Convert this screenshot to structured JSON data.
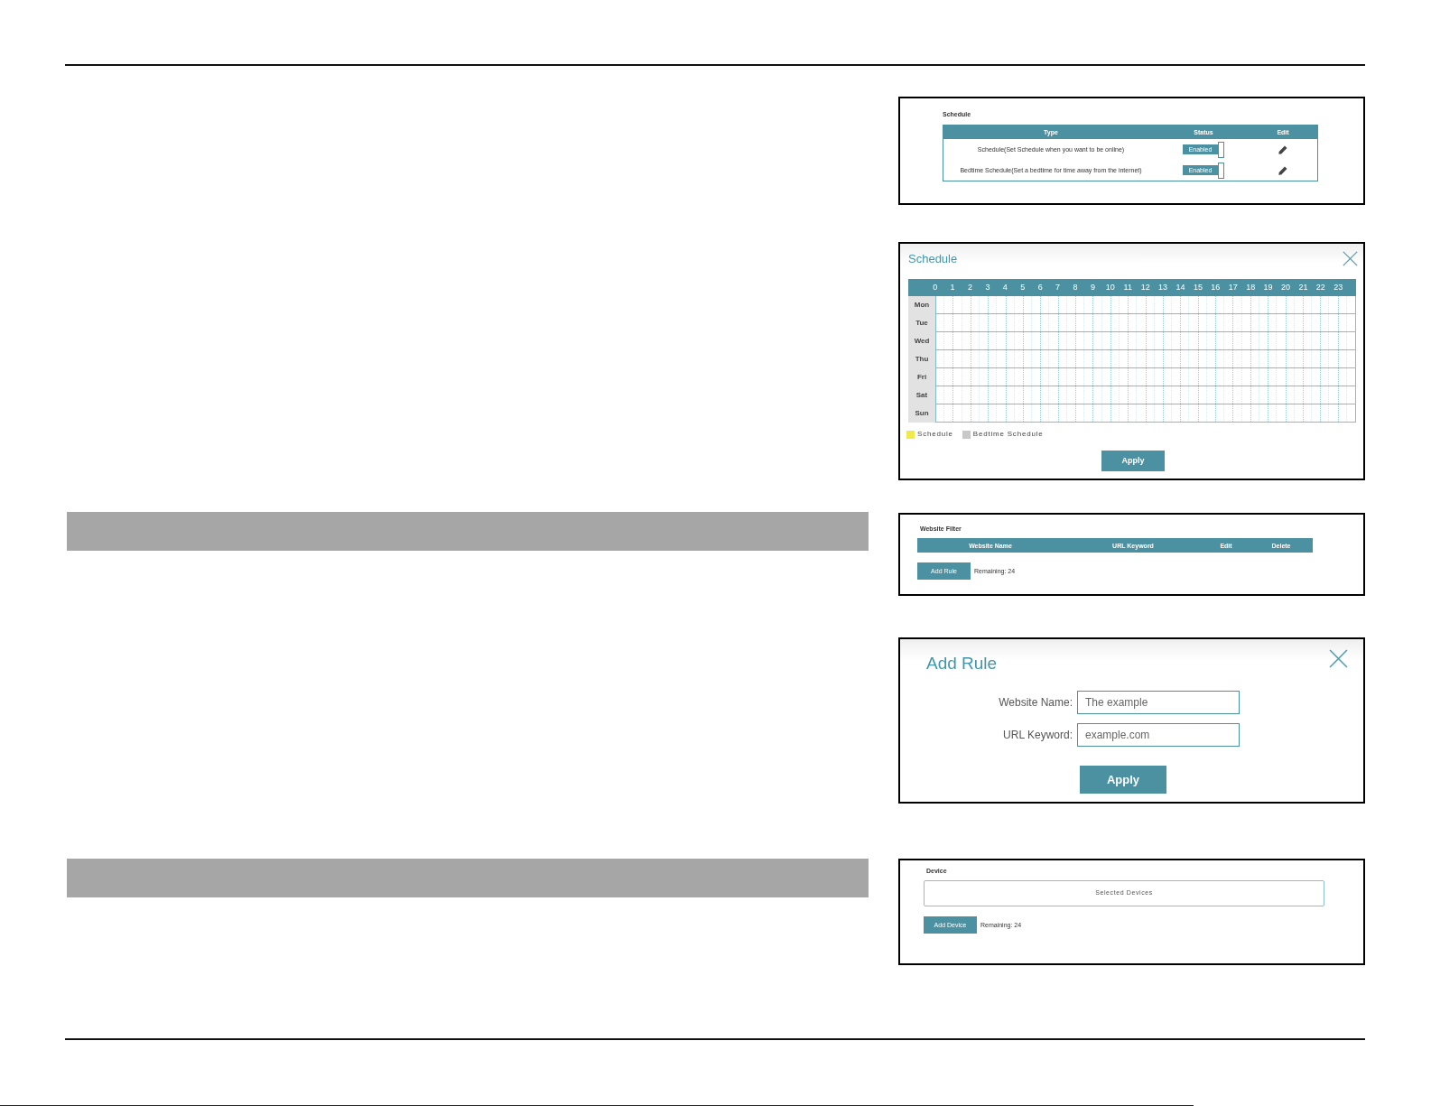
{
  "schedule_table_panel": {
    "title": "Schedule",
    "columns": [
      "Type",
      "Status",
      "Edit"
    ],
    "rows": [
      {
        "type": "Schedule(Set Schedule when you want to be online)",
        "status": "Enabled",
        "on": true
      },
      {
        "type": "Bedtime Schedule(Set a bedtime for time away from the internet)",
        "status": "Enabled",
        "on": true
      }
    ]
  },
  "schedule_dialog": {
    "title": "Schedule",
    "hours": [
      "0",
      "1",
      "2",
      "3",
      "4",
      "5",
      "6",
      "7",
      "8",
      "9",
      "10",
      "11",
      "12",
      "13",
      "14",
      "15",
      "16",
      "17",
      "18",
      "19",
      "20",
      "21",
      "22",
      "23"
    ],
    "days": [
      "Mon",
      "Tue",
      "Wed",
      "Thu",
      "Fri",
      "Sat",
      "Sun"
    ],
    "legend": [
      {
        "label": "Schedule",
        "color": "#f0e94c"
      },
      {
        "label": "Bedtime Schedule",
        "color": "#c8c8c8"
      }
    ],
    "apply_button": "Apply"
  },
  "website_filter_panel": {
    "title": "Website Filter",
    "columns": [
      "Website Name",
      "URL Keyword",
      "Edit",
      "Delete"
    ],
    "add_button": "Add Rule",
    "remaining": "Remaining: 24"
  },
  "add_rule_dialog": {
    "title": "Add Rule",
    "fields": [
      {
        "label": "Website Name:",
        "value": "The example"
      },
      {
        "label": "URL Keyword:",
        "value": "example.com"
      }
    ],
    "apply_button": "Apply"
  },
  "device_panel": {
    "title": "Device",
    "selected_box": "Selected Devices",
    "add_button": "Add Device",
    "remaining": "Remaining: 24"
  }
}
